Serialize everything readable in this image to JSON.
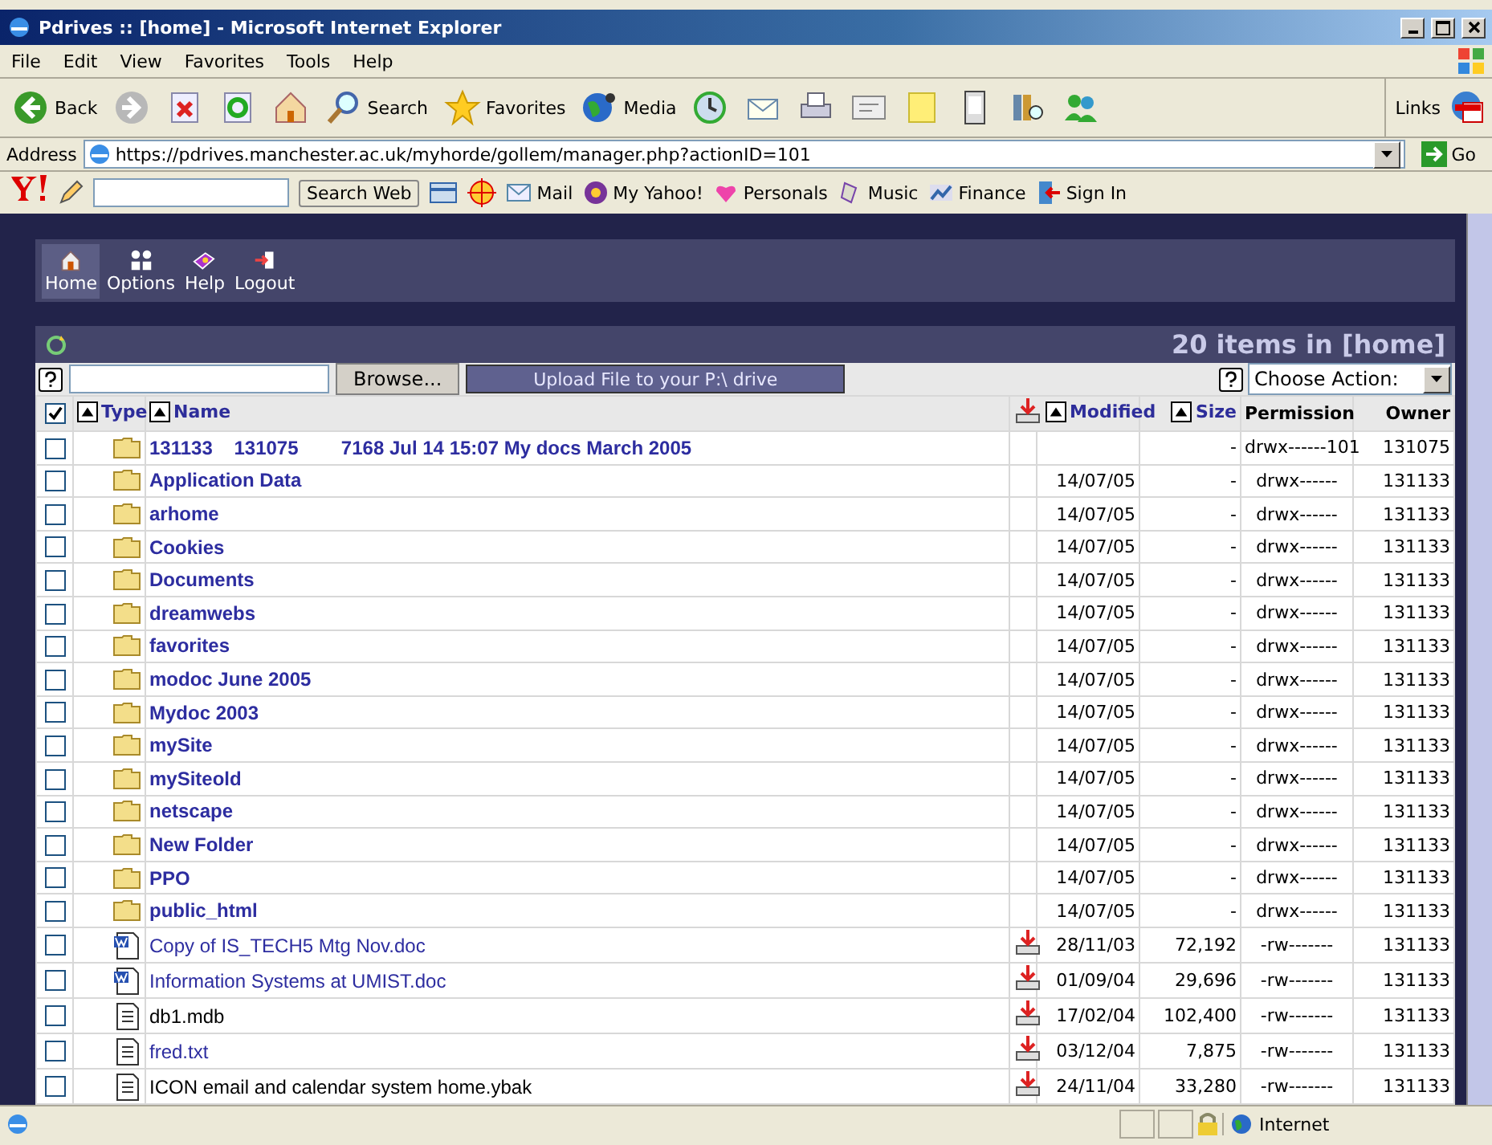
{
  "window": {
    "title": "Pdrives :: [home] - Microsoft Internet Explorer"
  },
  "menu": [
    "File",
    "Edit",
    "View",
    "Favorites",
    "Tools",
    "Help"
  ],
  "toolbar": [
    {
      "kind": "back",
      "label": "Back"
    },
    {
      "kind": "forward"
    },
    {
      "kind": "stop"
    },
    {
      "kind": "refresh"
    },
    {
      "kind": "home"
    },
    {
      "kind": "search",
      "label": "Search"
    },
    {
      "kind": "favorites",
      "label": "Favorites"
    },
    {
      "kind": "media",
      "label": "Media"
    },
    {
      "kind": "history"
    },
    {
      "kind": "mail"
    },
    {
      "kind": "print"
    },
    {
      "kind": "edit"
    },
    {
      "kind": "note"
    },
    {
      "kind": "device"
    },
    {
      "kind": "research"
    },
    {
      "kind": "messenger"
    }
  ],
  "links_label": "Links",
  "address": {
    "label": "Address",
    "url": "https://pdrives.manchester.ac.uk/myhorde/gollem/manager.php?actionID=101",
    "go": "Go"
  },
  "yahoo_bar": {
    "search_button": "Search Web",
    "items": [
      {
        "kind": "mail",
        "label": "Mail"
      },
      {
        "kind": "myyahoo",
        "label": "My Yahoo!"
      },
      {
        "kind": "personals",
        "label": "Personals"
      },
      {
        "kind": "music",
        "label": "Music"
      },
      {
        "kind": "finance",
        "label": "Finance"
      }
    ],
    "sign_in": "Sign In"
  },
  "nav": [
    {
      "kind": "home",
      "label": "Home",
      "selected": true
    },
    {
      "kind": "options",
      "label": "Options",
      "selected": false
    },
    {
      "kind": "help",
      "label": "Help",
      "selected": false
    },
    {
      "kind": "logout",
      "label": "Logout",
      "selected": false
    }
  ],
  "panel": {
    "count_label": "20 items in [home]",
    "upload_button": "Upload File to your P:\\ drive",
    "browse": "Browse...",
    "action_placeholder": "Choose Action:"
  },
  "table": {
    "select_all_checked": true,
    "columns": [
      {
        "label": "Type",
        "sortable": true
      },
      {
        "label": "Name",
        "sortable": true
      },
      {
        "label": "Modified",
        "sortable": true
      },
      {
        "label": "Size",
        "sortable": true
      },
      {
        "label": "Permission",
        "sortable": false
      },
      {
        "label": "Owner",
        "sortable": false
      }
    ],
    "rows": [
      {
        "kind": "folder",
        "name": "131133    131075        7168 Jul 14 15:07 My docs March 2005",
        "link": true,
        "modified": "",
        "size": "-",
        "permission": "drwx------101",
        "owner": "131075",
        "checked": false
      },
      {
        "kind": "folder",
        "name": "Application Data",
        "link": true,
        "modified": "14/07/05",
        "size": "-",
        "permission": "drwx------",
        "owner": "131133",
        "checked": false
      },
      {
        "kind": "folder",
        "name": "arhome",
        "link": true,
        "modified": "14/07/05",
        "size": "-",
        "permission": "drwx------",
        "owner": "131133",
        "checked": false
      },
      {
        "kind": "folder",
        "name": "Cookies",
        "link": true,
        "modified": "14/07/05",
        "size": "-",
        "permission": "drwx------",
        "owner": "131133",
        "checked": false
      },
      {
        "kind": "folder",
        "name": "Documents",
        "link": true,
        "modified": "14/07/05",
        "size": "-",
        "permission": "drwx------",
        "owner": "131133",
        "checked": false
      },
      {
        "kind": "folder",
        "name": "dreamwebs",
        "link": true,
        "modified": "14/07/05",
        "size": "-",
        "permission": "drwx------",
        "owner": "131133",
        "checked": false
      },
      {
        "kind": "folder",
        "name": "favorites",
        "link": true,
        "modified": "14/07/05",
        "size": "-",
        "permission": "drwx------",
        "owner": "131133",
        "checked": false
      },
      {
        "kind": "folder",
        "name": "modoc June 2005",
        "link": true,
        "modified": "14/07/05",
        "size": "-",
        "permission": "drwx------",
        "owner": "131133",
        "checked": false
      },
      {
        "kind": "folder",
        "name": "Mydoc 2003",
        "link": true,
        "modified": "14/07/05",
        "size": "-",
        "permission": "drwx------",
        "owner": "131133",
        "checked": false
      },
      {
        "kind": "folder",
        "name": "mySite",
        "link": true,
        "modified": "14/07/05",
        "size": "-",
        "permission": "drwx------",
        "owner": "131133",
        "checked": false
      },
      {
        "kind": "folder",
        "name": "mySiteold",
        "link": true,
        "modified": "14/07/05",
        "size": "-",
        "permission": "drwx------",
        "owner": "131133",
        "checked": false
      },
      {
        "kind": "folder",
        "name": "netscape",
        "link": true,
        "modified": "14/07/05",
        "size": "-",
        "permission": "drwx------",
        "owner": "131133",
        "checked": false
      },
      {
        "kind": "folder",
        "name": "New Folder",
        "link": true,
        "modified": "14/07/05",
        "size": "-",
        "permission": "drwx------",
        "owner": "131133",
        "checked": false
      },
      {
        "kind": "folder",
        "name": "PPO",
        "link": true,
        "modified": "14/07/05",
        "size": "-",
        "permission": "drwx------",
        "owner": "131133",
        "checked": false
      },
      {
        "kind": "folder",
        "name": "public_html",
        "link": true,
        "modified": "14/07/05",
        "size": "-",
        "permission": "drwx------",
        "owner": "131133",
        "checked": false
      },
      {
        "kind": "word",
        "name": "Copy of IS_TECH5 Mtg Nov.doc",
        "link": true,
        "modified": "28/11/03",
        "size": "72,192",
        "permission": "-rw-------",
        "owner": "131133",
        "checked": false
      },
      {
        "kind": "word",
        "name": "Information Systems at UMIST.doc",
        "link": true,
        "modified": "01/09/04",
        "size": "29,696",
        "permission": "-rw-------",
        "owner": "131133",
        "checked": false
      },
      {
        "kind": "text",
        "name": "db1.mdb",
        "link": false,
        "modified": "17/02/04",
        "size": "102,400",
        "permission": "-rw-------",
        "owner": "131133",
        "checked": false
      },
      {
        "kind": "text",
        "name": "fred.txt",
        "link": true,
        "modified": "03/12/04",
        "size": "7,875",
        "permission": "-rw-------",
        "owner": "131133",
        "checked": false
      },
      {
        "kind": "text",
        "name": "ICON email and calendar system home.ybak",
        "link": false,
        "modified": "24/11/04",
        "size": "33,280",
        "permission": "-rw-------",
        "owner": "131133",
        "checked": false
      }
    ]
  },
  "status": {
    "zone": "Internet"
  }
}
